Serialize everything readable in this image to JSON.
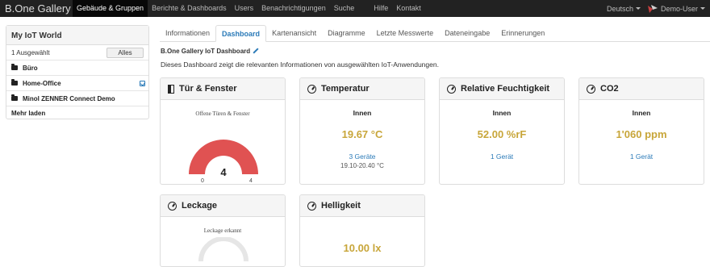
{
  "navbar": {
    "brand": "B.One Gallery",
    "items": [
      "Gebäude & Gruppen",
      "Berichte & Dashboards",
      "Users",
      "Benachrichtigungen",
      "Suche",
      "Hilfe",
      "Kontakt"
    ],
    "language": "Deutsch",
    "user": "Demo-User"
  },
  "sidebar": {
    "title": "My IoT World",
    "selected_count": "1 Ausgewählt",
    "all_button": "Alles",
    "items": [
      {
        "label": "Büro"
      },
      {
        "label": "Home-Office"
      },
      {
        "label": "Minol ZENNER Connect Demo"
      }
    ],
    "load_more": "Mehr laden"
  },
  "tabs": [
    "Informationen",
    "Dashboard",
    "Kartenansicht",
    "Diagramme",
    "Letzte Messwerte",
    "Dateneingabe",
    "Erinnerungen"
  ],
  "dashboard": {
    "title": "B.One Gallery IoT Dashboard",
    "description": "Dieses Dashboard zeigt die relevanten Informationen von ausgewählten IoT-Anwendungen."
  },
  "cards": {
    "doors": {
      "title": "Tür & Fenster",
      "gauge_label": "Offene Türen & Fenster",
      "value": 4,
      "min": "0",
      "max": "4",
      "value_text": "4"
    },
    "temperature": {
      "title": "Temperatur",
      "sub": "Innen",
      "value": "19.67 °C",
      "link": "3 Geräte",
      "range": "19.10-20.40 °C"
    },
    "humidity": {
      "title": "Relative Feuchtigkeit",
      "sub": "Innen",
      "value": "52.00 %rF",
      "link": "1 Gerät"
    },
    "co2": {
      "title": "CO2",
      "sub": "Innen",
      "value": "1'060 ppm",
      "link": "1 Gerät"
    },
    "leakage": {
      "title": "Leckage",
      "gauge_label": "Leckage erkannt"
    },
    "brightness": {
      "title": "Helligkeit",
      "value": "10.00 lx"
    }
  },
  "colors": {
    "accent": "#2a7ab8",
    "value": "#c8a63a",
    "gauge": "#e05252",
    "navbar": "#222222"
  }
}
